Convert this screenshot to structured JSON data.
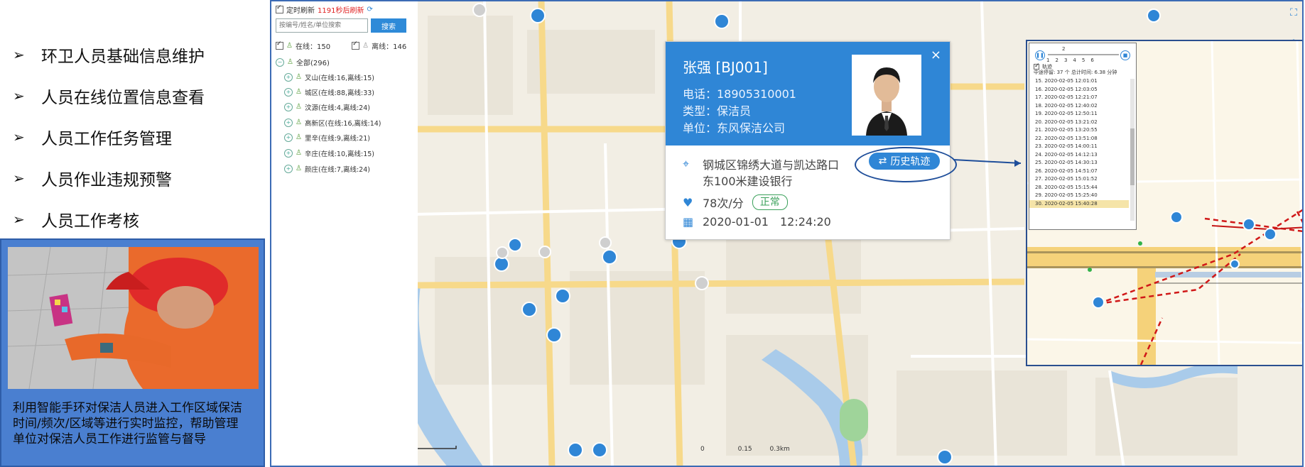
{
  "features": [
    {
      "label": "环卫人员基础信息维护"
    },
    {
      "label": "人员在线位置信息查看"
    },
    {
      "label": "人员工作任务管理"
    },
    {
      "label": "人员作业违规预警"
    },
    {
      "label": "人员工作考核"
    }
  ],
  "caption": [
    "利用智能手环对保洁人员进入工作区域保洁",
    "时间/频次/区域等进行实时监控，帮助管理",
    "单位对保洁人员工作进行监管与督导"
  ],
  "panel": {
    "timer_label": "定时刷新",
    "timer_countdown": "1191秒后刷新",
    "search_placeholder": "按编号/姓名/单位搜索",
    "search_button": "搜索",
    "online_label": "在线：150",
    "offline_label": "离线：146",
    "tree_root": "全部(296)",
    "tree_items": [
      {
        "label": "叉山(在线:16,离线:15)"
      },
      {
        "label": "城区(在线:88,离线:33)"
      },
      {
        "label": "汶源(在线:4,离线:24)"
      },
      {
        "label": "高新区(在线:16,离线:14)"
      },
      {
        "label": "里辛(在线:9,离线:21)"
      },
      {
        "label": "辛庄(在线:10,离线:15)"
      },
      {
        "label": "颜庄(在线:7,离线:24)"
      }
    ]
  },
  "popup": {
    "name": "张强 [BJ001]",
    "phone": "电话：18905310001",
    "type": "类型：保洁员",
    "unit": "单位：东风保洁公司",
    "address_line1": "钢城区锦绣大道与凯达路口",
    "address_line2": "东100米建设银行",
    "heart_rate": "78次/分",
    "status": "正常",
    "date": "2020-01-01",
    "time": "12:24:20",
    "track_button": "历史轨迹",
    "close": "×"
  },
  "history": {
    "speed_top": "2",
    "speeds": [
      "1",
      "2",
      "3",
      "4",
      "5",
      "6"
    ],
    "summary_label": "轨迹",
    "summary": "中途停留: 37 个  总计时间: 6.38 分钟",
    "rows": [
      "15. 2020-02-05 12:01:01",
      "16. 2020-02-05 12:03:05",
      "17. 2020-02-05 12:21:07",
      "18. 2020-02-05 12:40:02",
      "19. 2020-02-05 12:50:11",
      "20. 2020-02-05 13:21:02",
      "21. 2020-02-05 13:20:55",
      "22. 2020-02-05 13:51:08",
      "23. 2020-02-05 14:00:11",
      "24. 2020-02-05 14:12:13",
      "25. 2020-02-05 14:30:13",
      "26. 2020-02-05 14:51:07",
      "27. 2020-02-05 15:01:52",
      "28. 2020-02-05 15:15:44",
      "29. 2020-02-05 15:25:40",
      "30. 2020-02-05 15:40:28"
    ]
  },
  "scale": {
    "s0": "0",
    "s1": "0.15",
    "s2": "0.3km"
  },
  "colors": {
    "accent": "#2f86d6",
    "track": "#d01818",
    "frame": "#2a4f8f"
  }
}
